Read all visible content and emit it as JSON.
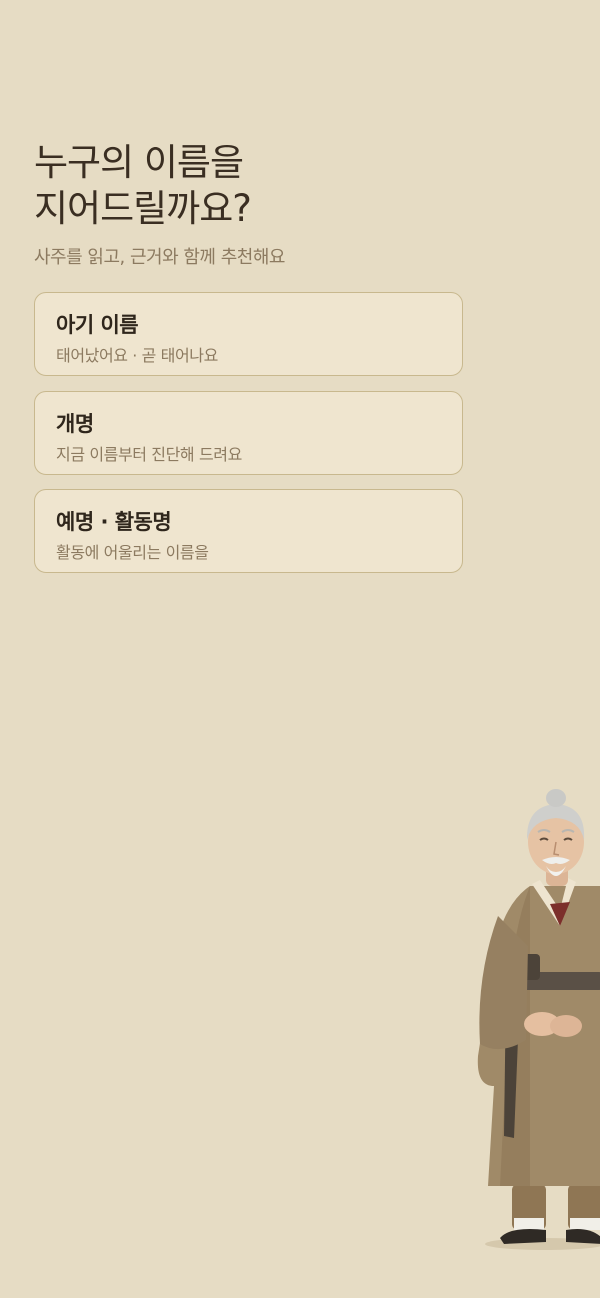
{
  "header": {
    "title_line1": "누구의 이름을",
    "title_line2": "지어드릴까요?",
    "subtitle": "사주를 읽고, 근거와 함께 추천해요"
  },
  "options": [
    {
      "title": "아기 이름",
      "description": "태어났어요 · 곧 태어나요"
    },
    {
      "title": "개명",
      "description": "지금 이름부터 진단해 드려요"
    },
    {
      "title": "예명 · 활동명",
      "description": "활동에 어울리는 이름을"
    }
  ],
  "illustration": {
    "icon": "elderly-sage-in-hanbok"
  },
  "colors": {
    "background": "#e6dcc4",
    "card": "#efe5cf",
    "card_border": "#c8b88e",
    "title": "#3a2e22",
    "muted": "#8c7a60"
  }
}
